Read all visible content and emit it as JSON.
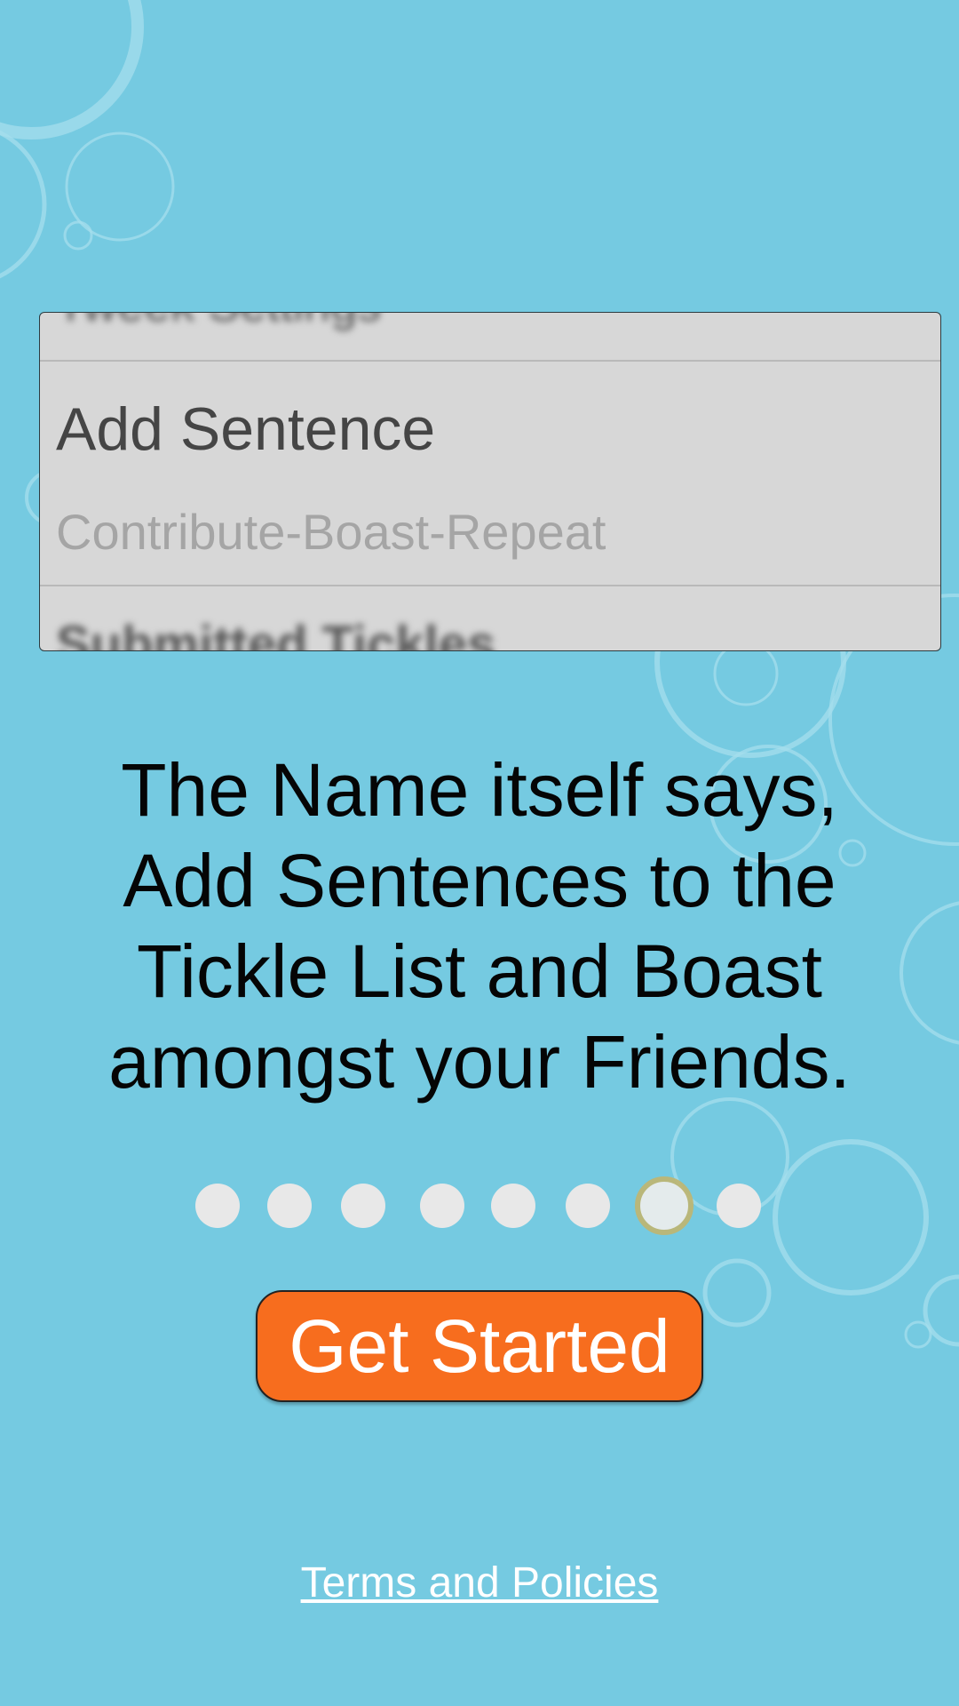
{
  "preview": {
    "top_partial_item": "Tweek Settings",
    "item_title": "Add Sentence",
    "item_subtitle": "Contribute-Boast-Repeat",
    "bottom_partial_item": "Submitted Tickles"
  },
  "headline": {
    "line1": "The Name itself says,",
    "line2": "Add Sentences to the",
    "line3": "Tickle List and Boast",
    "line4": "amongst your Friends."
  },
  "pager": {
    "total_pages": 8,
    "current_page": 7
  },
  "cta": {
    "label": "Get Started"
  },
  "footer": {
    "terms_link": "Terms and Policies"
  },
  "colors": {
    "background": "#75cae1",
    "button": "#f76d1e",
    "active_dot_ring": "#bfb672"
  }
}
